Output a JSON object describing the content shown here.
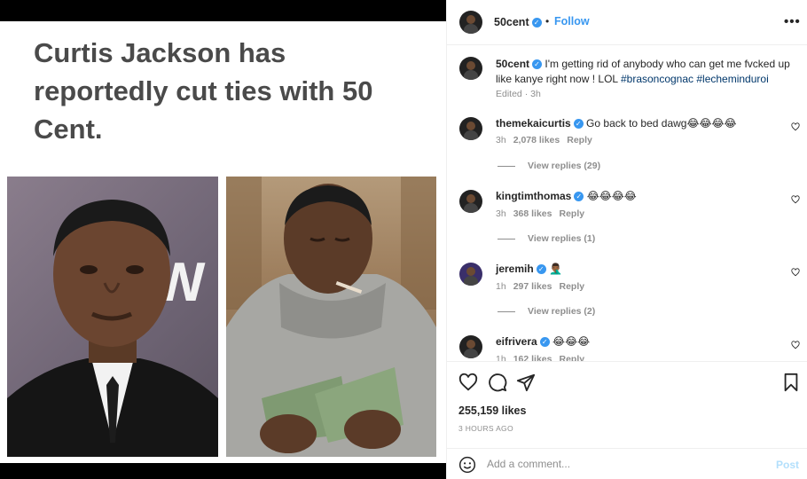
{
  "media": {
    "headline": "Curtis Jackson has reportedly cut ties with 50 Cent."
  },
  "header": {
    "username": "50cent",
    "separator": "•",
    "follow_label": "Follow",
    "more_label": "•••"
  },
  "caption": {
    "username": "50cent",
    "text": "I'm getting rid of anybody who can get me fvcked up like kanye right now ! LOL",
    "hashtags": "#brasoncognac #lecheminduroi",
    "edited": "Edited · 3h"
  },
  "comments": [
    {
      "username": "themekaicurtis",
      "text": "Go back to bed dawg😂😂😂😂",
      "age": "3h",
      "likes": "2,078 likes",
      "reply": "Reply",
      "view_replies": "View replies (29)"
    },
    {
      "username": "kingtimthomas",
      "text": "😂😂😂😂",
      "age": "3h",
      "likes": "368 likes",
      "reply": "Reply",
      "view_replies": "View replies (1)"
    },
    {
      "username": "jeremih",
      "text": "🤦🏾‍♂️",
      "age": "1h",
      "likes": "297 likes",
      "reply": "Reply",
      "view_replies": "View replies (2)"
    },
    {
      "username": "eifrivera",
      "text": "😂😂😂",
      "age": "1h",
      "likes": "162 likes",
      "reply": "Reply"
    }
  ],
  "footer": {
    "likes": "255,159 likes",
    "time": "3 HOURS AGO",
    "comment_placeholder": "Add a comment...",
    "post_label": "Post"
  },
  "icons": {
    "like": "heart-icon",
    "comment": "comment-icon",
    "share": "share-icon",
    "save": "bookmark-icon",
    "emoji": "smiley-icon"
  },
  "colors": {
    "link": "#3897f0",
    "hashtag": "#00376b",
    "muted": "#8e8e8e",
    "post_disabled": "#b2dffc"
  }
}
